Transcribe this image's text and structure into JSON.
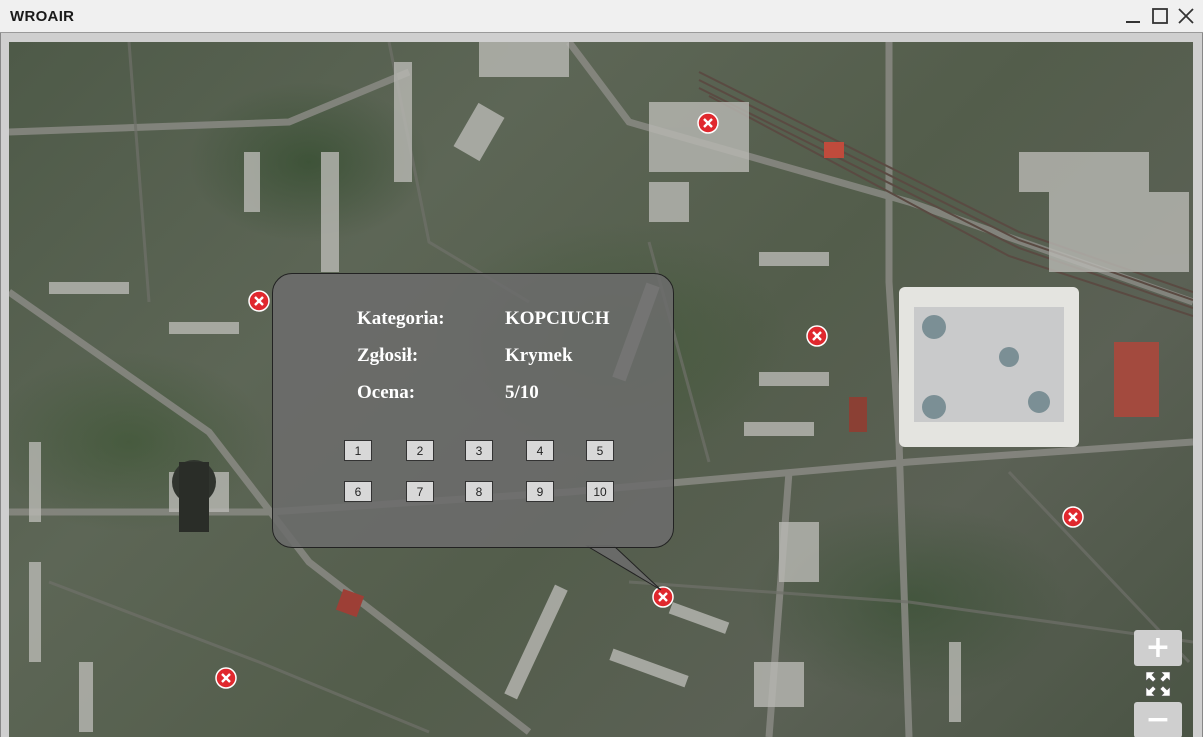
{
  "window": {
    "title": "WROAIR",
    "minimize_icon": "minimize-icon",
    "maximize_icon": "maximize-icon",
    "close_icon": "close-icon"
  },
  "map": {
    "type": "satellite",
    "marker_icon": "red-x-marker-icon",
    "marker_color": "#e0282e",
    "marker_count": 7
  },
  "popup": {
    "rows": [
      {
        "label": "Kategoria:",
        "value": "KOPCIUCH"
      },
      {
        "label": "Zgłosił:",
        "value": "Krymek"
      },
      {
        "label": "Ocena:",
        "value": "5/10"
      }
    ],
    "rating_buttons": [
      "1",
      "2",
      "3",
      "4",
      "5",
      "6",
      "7",
      "8",
      "9",
      "10"
    ]
  },
  "zoom_controls": {
    "zoom_in": "+",
    "fullscreen_icon": "fullscreen-icon",
    "zoom_out": "−"
  }
}
